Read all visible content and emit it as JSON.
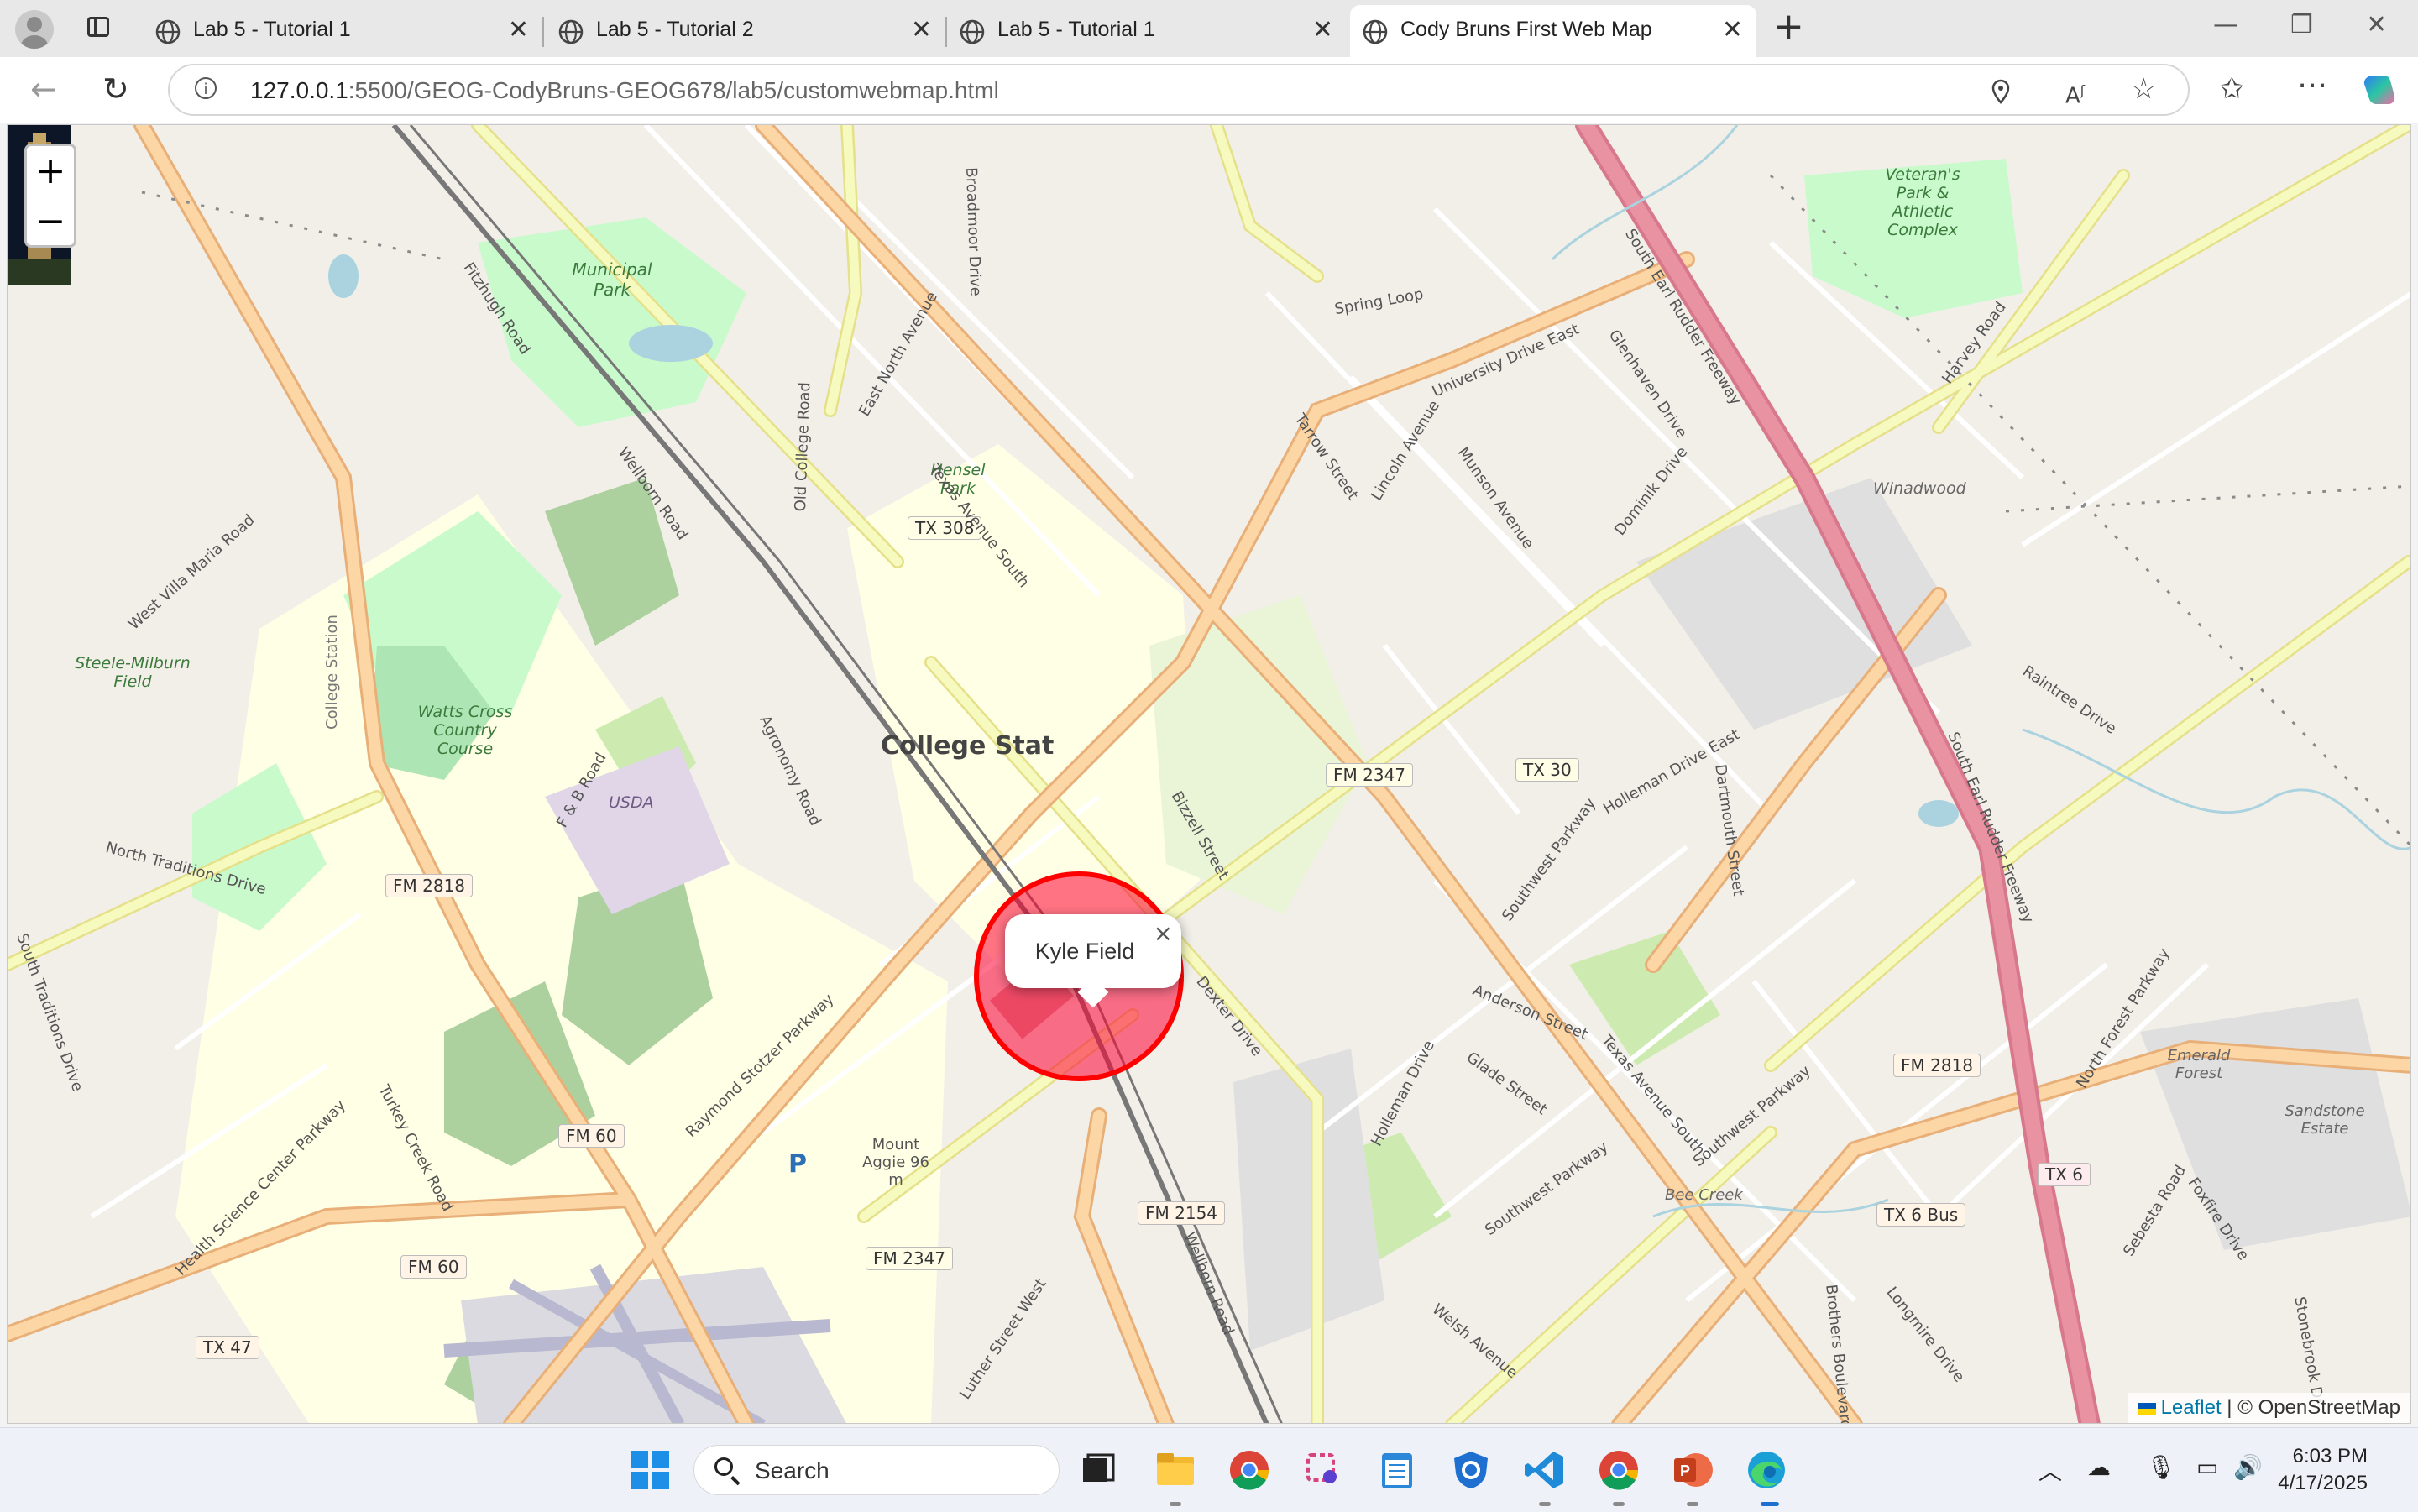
{
  "tabs": [
    {
      "title": "Lab 5 - Tutorial 1"
    },
    {
      "title": "Lab 5 - Tutorial 2"
    },
    {
      "title": "Lab 5 - Tutorial 1"
    },
    {
      "title": "Cody Bruns First Web Map"
    }
  ],
  "window_controls": {
    "minimize": "—",
    "restore": "❐",
    "close": "✕"
  },
  "address_bar": {
    "host": "127.0.0.1",
    "path": ":5500/GEOG-CodyBruns-GEOG678/lab5/customwebmap.html"
  },
  "map": {
    "zoom_in": "+",
    "zoom_out": "−",
    "popup": {
      "text": "Kyle Field",
      "close": "×"
    },
    "attribution": {
      "leaflet": "Leaflet",
      "rest": " | © OpenStreetMap"
    },
    "place_labels": {
      "college_station": "College Stat",
      "municipal_park": "Municipal Park",
      "hensel_park": "Hensel Park",
      "watts_cross": "Watts Cross Country Course",
      "steele_milburn": "Steele-Milburn Field",
      "usda": "USDA",
      "veterans_park": "Veteran's Park & Athletic Complex",
      "winadwood": "Winadwood",
      "emerald_forest": "Emerald Forest",
      "sandstone_estate": "Sandstone Estate",
      "mount_aggie": "Mount Aggie 96 m",
      "bee_creek": "Bee Creek",
      "college_station_st": "College Station"
    },
    "road_shields": [
      "TX 308",
      "FM 2347",
      "TX 30",
      "FM 2818",
      "FM 2818",
      "FM 60",
      "FM 60",
      "FM 2154",
      "FM 2347",
      "TX 6 Bus",
      "TX 6",
      "TX 47"
    ],
    "street_labels": [
      "University Drive East",
      "Texas Avenue South",
      "Wellborn Road",
      "Wellborn Road",
      "South Earl Rudder Freeway",
      "South Earl Rudder Freeway",
      "Raymond Stotzer Parkway",
      "Southwest Parkway",
      "Holleman Drive East",
      "Texas Avenue South",
      "Harvey Road",
      "Spring Loop",
      "Munson Avenue",
      "Dominik Drive",
      "Glenhaven Drive",
      "North Traditions Drive",
      "F & B Road",
      "Agronomy Road",
      "East North Avenue",
      "Old College Road",
      "West Villa Maria Road",
      "Dartmouth Street",
      "Anderson Street",
      "Glade Street",
      "Holleman Drive",
      "Southwest Parkway",
      "Welsh Avenue",
      "Luther Street West",
      "Health Science Center Parkway",
      "Turkey Creek Road",
      "North Forest Parkway",
      "Raintree Drive",
      "Longmire Drive",
      "Brothers Boulevard",
      "Sebesta Road",
      "Foxfire Drive",
      "Dexter Drive",
      "Bizzell Street",
      "Tarrow Street",
      "Lincoln Avenue",
      "Fitzhugh Road",
      "Broadmoor Drive",
      "Southwest Parkway",
      "South Traditions Drive",
      "Stonebrook Dr"
    ]
  },
  "taskbar": {
    "search_placeholder": "Search",
    "time": "6:03 PM",
    "date": "4/17/2025"
  },
  "colors": {
    "map_bg": "#f2efe9",
    "motorway": "#e892a2",
    "primary_road": "#fcd6a4",
    "secondary_road": "#f7fabf",
    "park": "#c8facc",
    "campus": "#ffffe5",
    "popup_circle": "#ff0000"
  }
}
